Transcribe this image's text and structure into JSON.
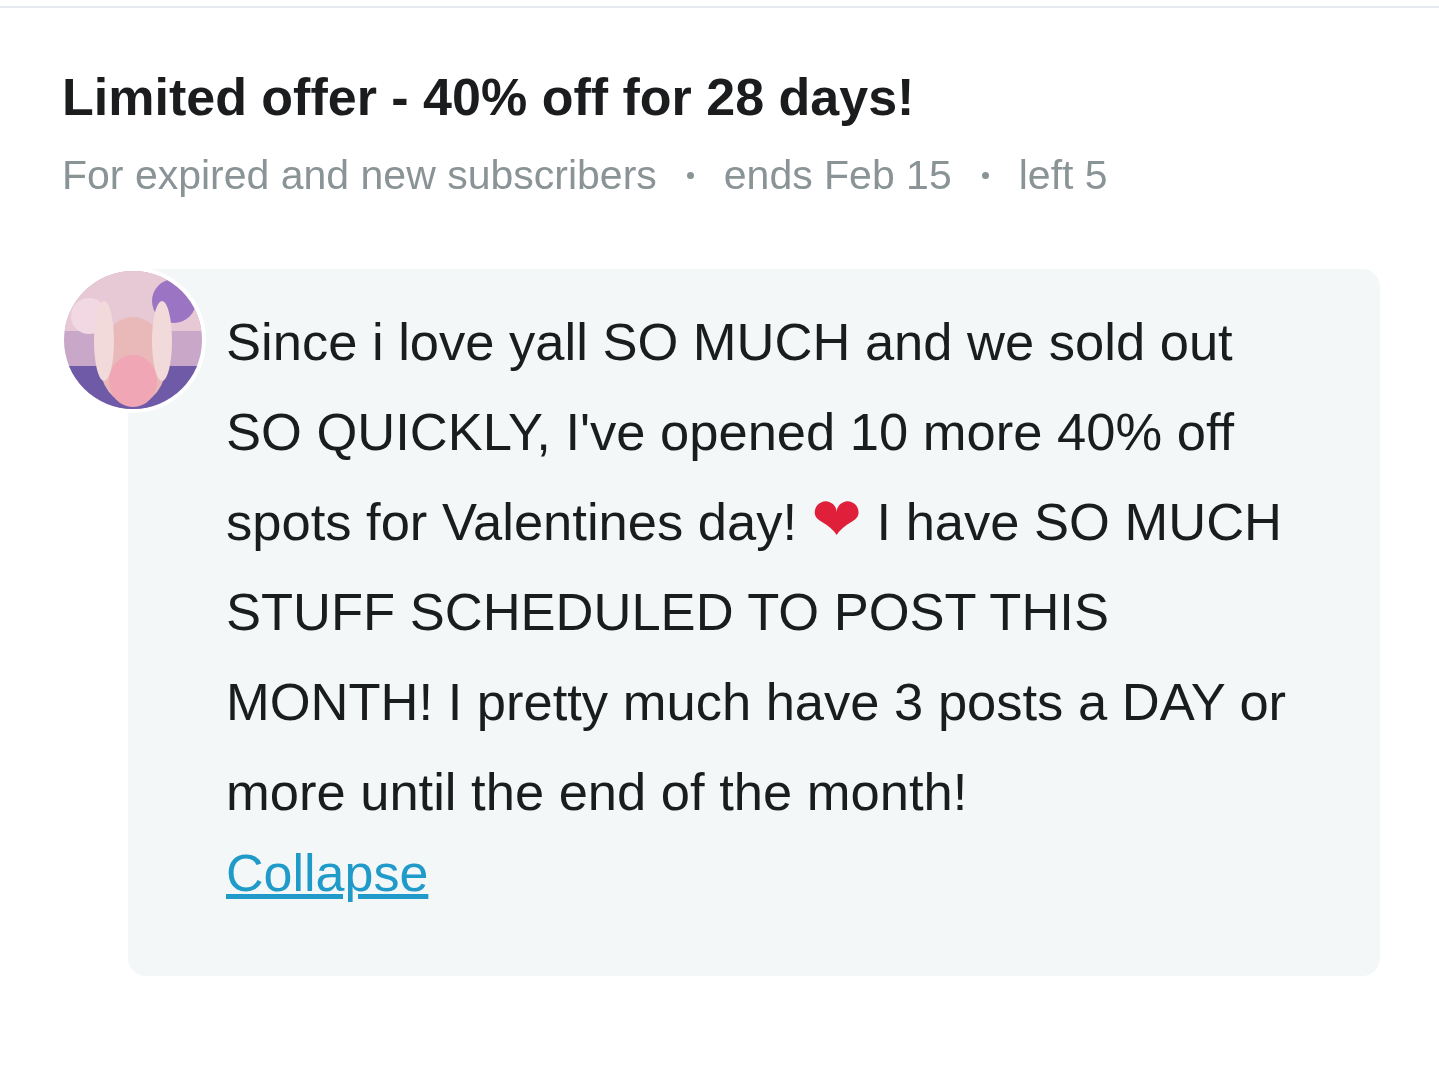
{
  "offer": {
    "title": "Limited offer - 40% off for 28 days!",
    "meta": [
      "For expired and new subscribers",
      "ends Feb 15",
      "left 5"
    ]
  },
  "message": {
    "text_before_icon": "Since i love yall SO MUCH and we sold out SO QUICKLY, I've opened 10 more 40% off spots for Valentines day!",
    "emoji": "❤",
    "text_after_icon": "I have SO MUCH STUFF SCHEDULED TO POST THIS MONTH! I pretty much have 3 posts a DAY or more until the end of the month!",
    "collapse_link": "Collapse"
  }
}
